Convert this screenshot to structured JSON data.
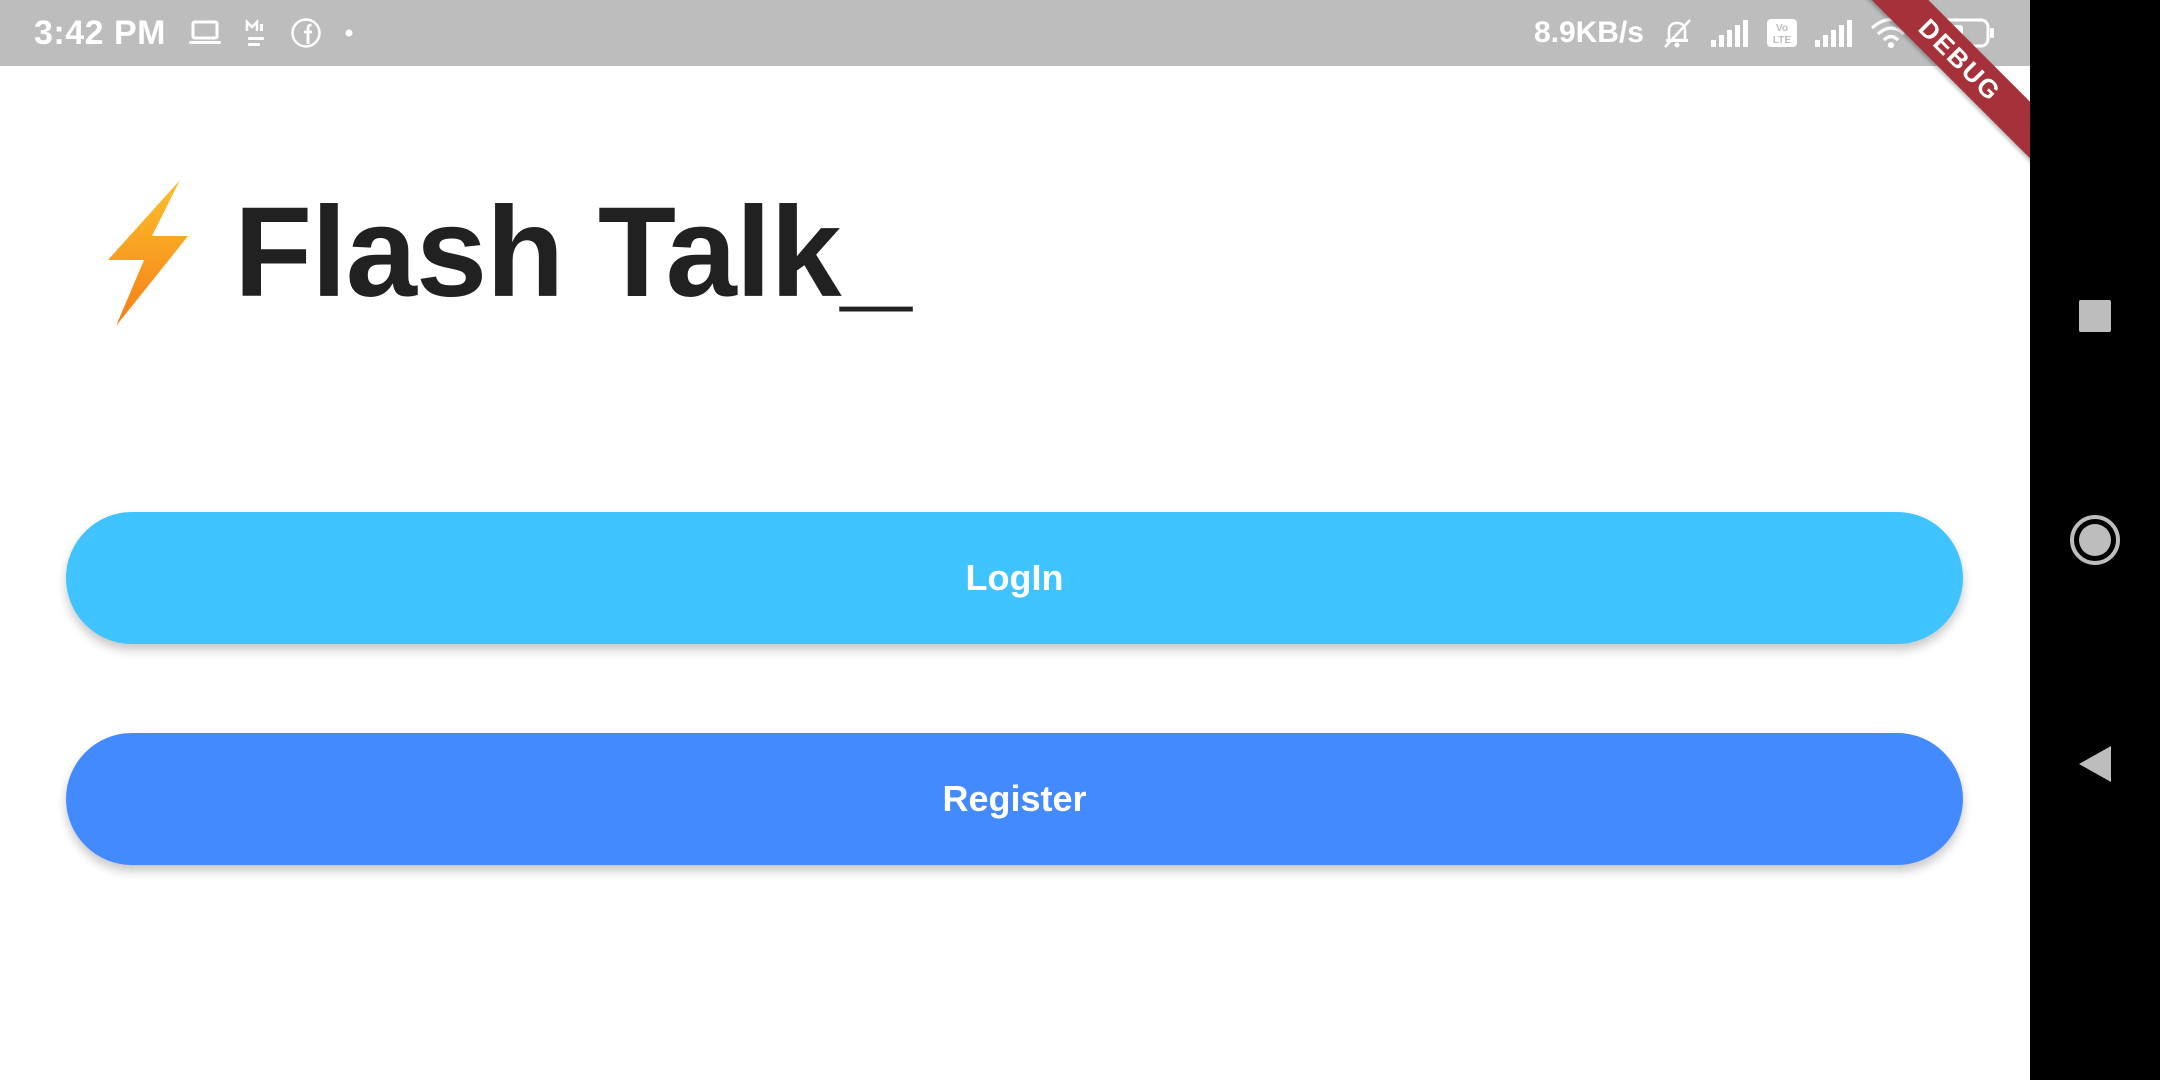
{
  "status_bar": {
    "time": "3:42 PM",
    "network_speed": "8.9KB/s",
    "left_icons": [
      "laptop-icon",
      "mi-pay-icon",
      "facebook-icon",
      "dot-icon"
    ],
    "mi_pay_label": "Mi Pay",
    "volte_label": "Vo LTE",
    "right_icons": [
      "mute-bell-icon",
      "signal-icon",
      "volte-icon",
      "signal-icon",
      "wifi-icon",
      "battery-icon"
    ]
  },
  "debug_banner": "DEBUG",
  "app": {
    "title": "Flash Talk_",
    "title_icon": "lightning-bolt-icon"
  },
  "buttons": {
    "login_label": "LogIn",
    "register_label": "Register"
  },
  "colors": {
    "status_bar_bg": "#bdbdbd",
    "login_button": "#40c4ff",
    "register_button": "#448aff",
    "title_text": "#212121",
    "bolt": "#f9a825",
    "debug_banner": "#a5323a"
  },
  "nav_bar": {
    "items": [
      "recents-square-icon",
      "home-circle-icon",
      "back-triangle-icon"
    ]
  }
}
